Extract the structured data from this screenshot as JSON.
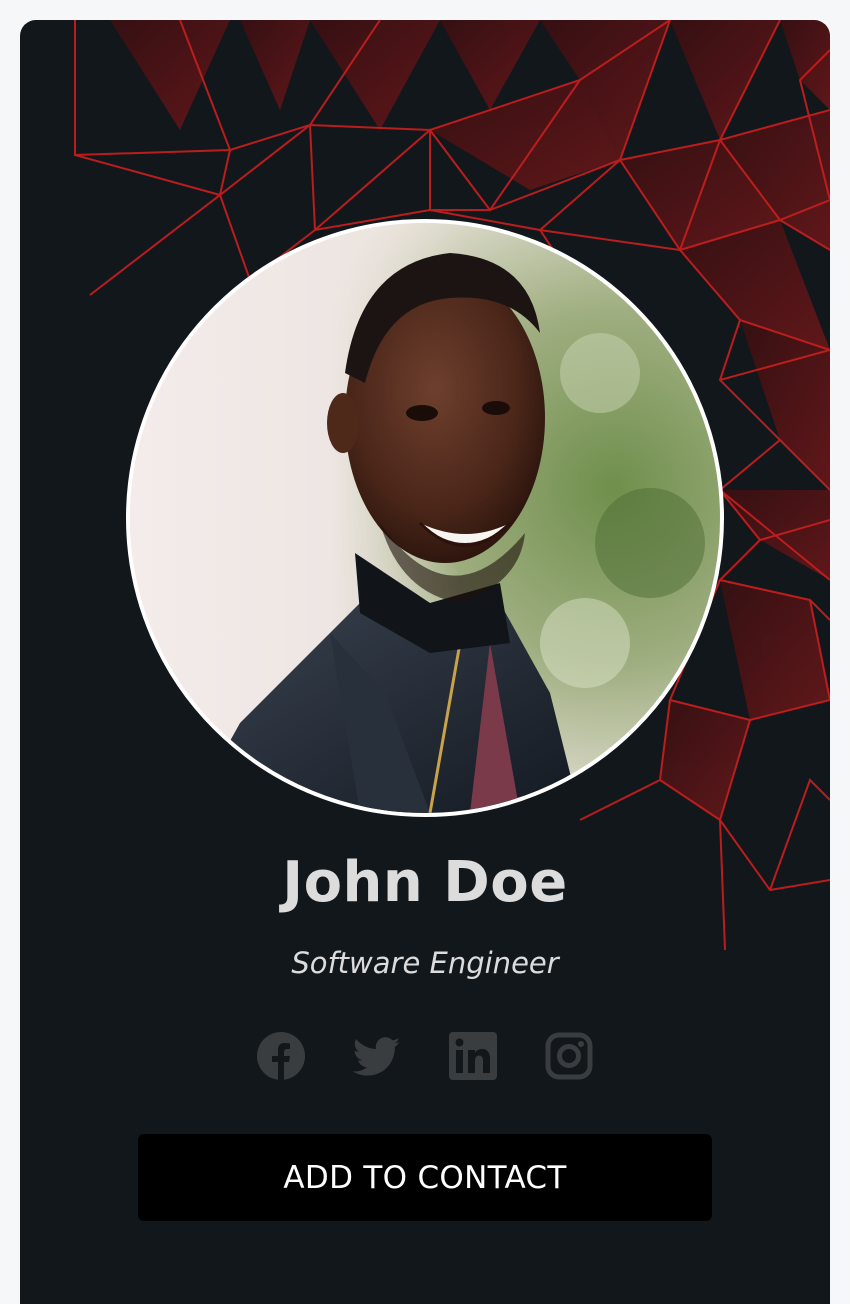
{
  "profile": {
    "name": "John Doe",
    "title": "Software Engineer"
  },
  "socials": [
    {
      "name": "facebook",
      "icon": "facebook-icon"
    },
    {
      "name": "twitter",
      "icon": "twitter-icon"
    },
    {
      "name": "linkedin",
      "icon": "linkedin-icon"
    },
    {
      "name": "instagram",
      "icon": "instagram-icon"
    }
  ],
  "actions": {
    "add_contact_label": "ADD TO CONTACT"
  },
  "colors": {
    "card_background": "#12171c",
    "page_background": "#f6f7f9",
    "accent_red": "#c41e1e",
    "text": "#dcdcdc",
    "social_icon": "#3a3d40",
    "button_background": "#000000",
    "button_text": "#ffffff"
  }
}
